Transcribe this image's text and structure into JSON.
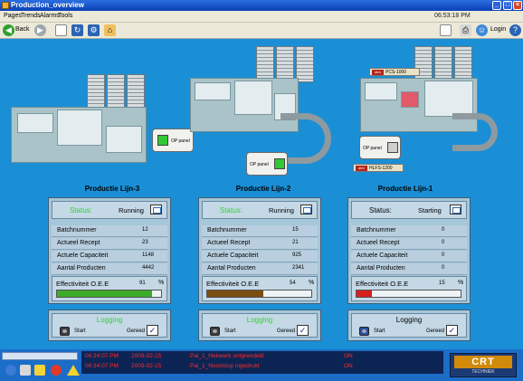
{
  "window": {
    "title": "Production_overview"
  },
  "menu": {
    "items": [
      "Pages",
      "Trends",
      "Alarms",
      "Tools"
    ],
    "clock": "06:53:18 PM"
  },
  "toolbar": {
    "back_label": "Back",
    "login_label": "Login"
  },
  "tags": {
    "pcs": "PCS-1000",
    "hlfs": "HLFS-1200",
    "op_panel": "OP panel"
  },
  "lines": [
    {
      "title": "Productie Lijn-3",
      "status_label": "Status:",
      "status_value": "Running",
      "rows": [
        {
          "label": "Batchnummer",
          "value": "12"
        },
        {
          "label": "Actueel Recept",
          "value": "23"
        },
        {
          "label": "Actuele Capaciteit",
          "value": "1148"
        },
        {
          "label": "Aantal Producten",
          "value": "4442"
        }
      ],
      "oee_label": "Effectiviteit O.E.E",
      "oee_value": "91",
      "oee_unit": "%",
      "oee_fraction": 0.91,
      "oee_color": "#3cab2a",
      "logging_title": "Logging",
      "start_label": "Start",
      "done_label": "Gereed",
      "logging_active": true
    },
    {
      "title": "Productie Lijn-2",
      "status_label": "Status:",
      "status_value": "Running",
      "rows": [
        {
          "label": "Batchnummer",
          "value": "15"
        },
        {
          "label": "Actueel Recept",
          "value": "21"
        },
        {
          "label": "Actuele Capaciteit",
          "value": "925"
        },
        {
          "label": "Aantal Producten",
          "value": "2341"
        }
      ],
      "oee_label": "Effectiviteit O.E.E",
      "oee_value": "54",
      "oee_unit": "%",
      "oee_fraction": 0.54,
      "oee_color": "#7a4d10",
      "logging_title": "Logging",
      "start_label": "Start",
      "done_label": "Gereed",
      "logging_active": true
    },
    {
      "title": "Productie Lijn-1",
      "status_label": "Status:",
      "status_value": "Starting",
      "rows": [
        {
          "label": "Batchnummer",
          "value": "0"
        },
        {
          "label": "Actueel Recept",
          "value": "0"
        },
        {
          "label": "Actuele Capaciteit",
          "value": "0"
        },
        {
          "label": "Aantal Producten",
          "value": "0"
        }
      ],
      "oee_label": "Effectiviteit O.E.E",
      "oee_value": "15",
      "oee_unit": "%",
      "oee_fraction": 0.15,
      "oee_color": "#d81e1e",
      "logging_title": "Logging",
      "start_label": "Start",
      "done_label": "Gereed",
      "logging_active": false
    }
  ],
  "alarms": [
    {
      "time": "06:34:07 PM",
      "date": "2009-02-15",
      "message": "Pal_1_Hekwerk ontgrendeld",
      "state": "ON"
    },
    {
      "time": "06:34:07 PM",
      "date": "2009-02-15",
      "message": "Pal_1_Noodstop ingedrukt",
      "state": "ON"
    }
  ],
  "brand": {
    "name": "CRT",
    "sub": "TECHNIEK"
  },
  "colors": {
    "status_active": "#2dd62d",
    "alarm_text": "#ff2a2a"
  }
}
